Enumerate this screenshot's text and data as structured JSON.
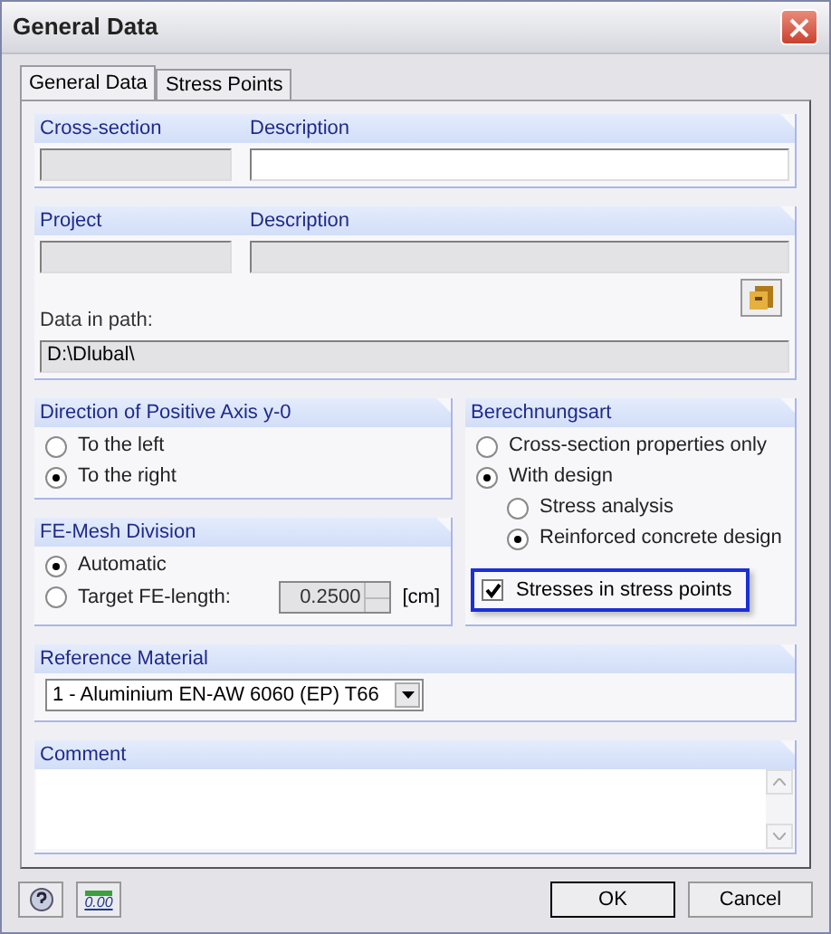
{
  "window": {
    "title": "General Data"
  },
  "tabs": [
    {
      "label": "General Data",
      "selected": true
    },
    {
      "label": "Stress Points",
      "selected": false
    }
  ],
  "cross_section": {
    "label": "Cross-section",
    "description_label": "Description"
  },
  "project": {
    "label": "Project",
    "description_label": "Description",
    "path_label": "Data in path:",
    "path_value": "D:\\Dlubal\\"
  },
  "direction": {
    "title": "Direction of Positive Axis y-0",
    "options": [
      {
        "label": "To the left",
        "selected": false
      },
      {
        "label": "To the right",
        "selected": true
      }
    ]
  },
  "fe_mesh": {
    "title": "FE-Mesh Division",
    "options": [
      {
        "label": "Automatic",
        "selected": true
      },
      {
        "label": "Target FE-length:",
        "selected": false
      }
    ],
    "length_value": "0.2500",
    "length_disabled": true,
    "unit": "[cm]"
  },
  "calculation": {
    "title": "Berechnungsart",
    "options": [
      {
        "label": "Cross-section properties only",
        "selected": false
      },
      {
        "label": "With design",
        "selected": true,
        "children": [
          {
            "label": "Stress analysis",
            "selected": false
          },
          {
            "label": "Reinforced concrete design",
            "selected": true
          }
        ]
      }
    ]
  },
  "stress_points_checkbox": {
    "label": "Stresses in stress points",
    "checked": true,
    "focused": true
  },
  "reference_material": {
    "title": "Reference Material",
    "value": "1 - Aluminium EN-AW 6060 (EP) T66"
  },
  "comment": {
    "title": "Comment"
  },
  "tools": [
    {
      "kind": "help"
    },
    {
      "kind": "decimals",
      "label": "0.00"
    }
  ],
  "buttons": [
    {
      "label": "OK",
      "default": true
    },
    {
      "label": "Cancel",
      "default": false
    }
  ]
}
